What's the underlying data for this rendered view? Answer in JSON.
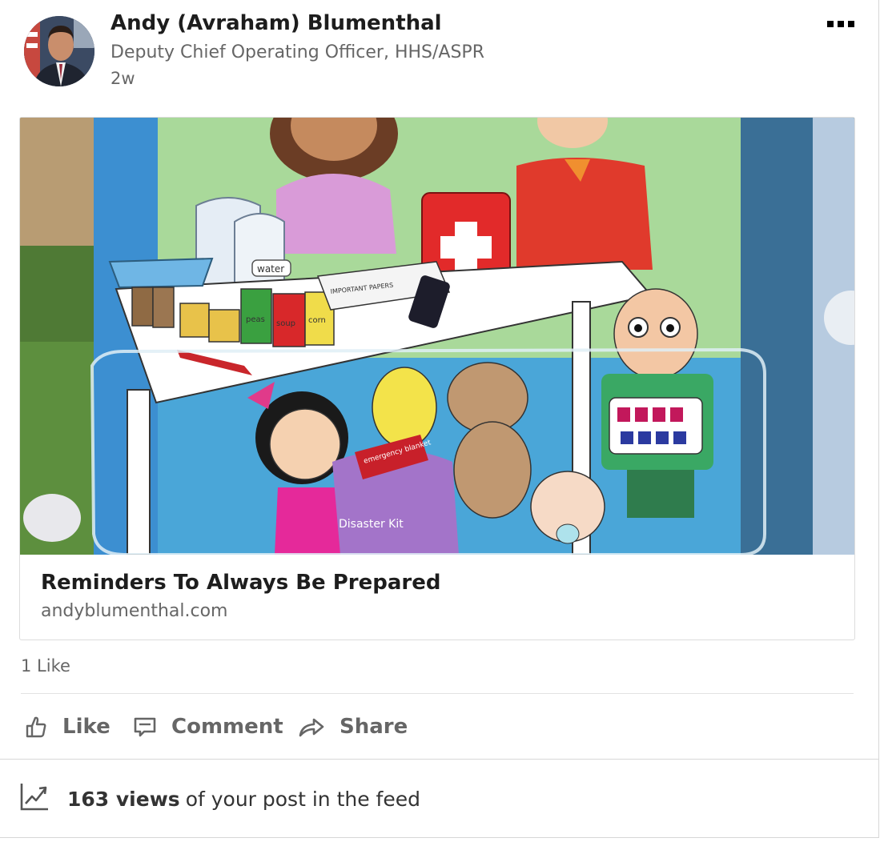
{
  "post": {
    "author_name": "Andy (Avraham) Blumenthal",
    "author_title": "Deputy Chief Operating Officer, HHS/ASPR",
    "age": "2w"
  },
  "link_preview": {
    "title": "Reminders To Always Be Prepared",
    "domain": "andyblumenthal.com",
    "image_text": {
      "water_label": "water",
      "papers_label": "IMPORTANT PAPERS",
      "can_labels": [
        "peas",
        "soup",
        "corn"
      ],
      "blanket_label": "emergency blanket",
      "kit_label": "Disaster Kit"
    }
  },
  "social": {
    "likes": "1 Like"
  },
  "actions": {
    "like": "Like",
    "comment": "Comment",
    "share": "Share"
  },
  "analytics": {
    "views_number": "163 views",
    "views_rest": "of your post in the feed"
  },
  "icons": {
    "more": "more-icon",
    "like": "thumbs-up-icon",
    "comment": "comment-icon",
    "share": "share-arrow-icon",
    "analytics": "trending-chart-icon"
  },
  "colors": {
    "text_primary": "#1d1d1d",
    "text_secondary": "#666666",
    "divider": "#e3e3e3"
  }
}
